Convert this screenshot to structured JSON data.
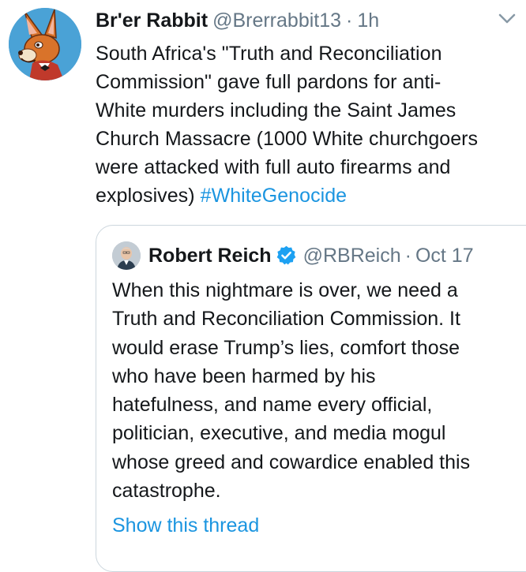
{
  "tweet": {
    "avatar_icon": "rabbit-avatar-icon",
    "display_name": "Br'er Rabbit",
    "handle": "@Brerrabbit13",
    "separator": "·",
    "time": "1h",
    "menu_icon": "chevron-down-icon",
    "text": "South Africa's \"Truth and Reconciliation\nCommission\" gave full pardons for anti-\nWhite murders including the Saint James\nChurch Massacre (1000 White churchgoers\nwere attacked with full auto firearms and\nexplosives) ",
    "hashtag": "#WhiteGenocide"
  },
  "quote": {
    "avatar_icon": "profile-photo-icon",
    "display_name": "Robert Reich",
    "verified_icon": "verified-badge-icon",
    "handle": "@RBReich",
    "separator": "·",
    "time": "Oct 17",
    "text": "When this nightmare is over, we need a\nTruth and Reconciliation Commission. It\nwould erase Trump’s lies, comfort those\nwho have been harmed by his\nhatefulness, and name every official,\npolitician, executive, and media mogul\nwhose greed and cowardice enabled this\ncatastrophe.",
    "show_thread": "Show this thread"
  },
  "colors": {
    "text": "#14171a",
    "secondary": "#657786",
    "link": "#1b95e0",
    "border": "#ccd6dd",
    "verified": "#1da1f2"
  }
}
